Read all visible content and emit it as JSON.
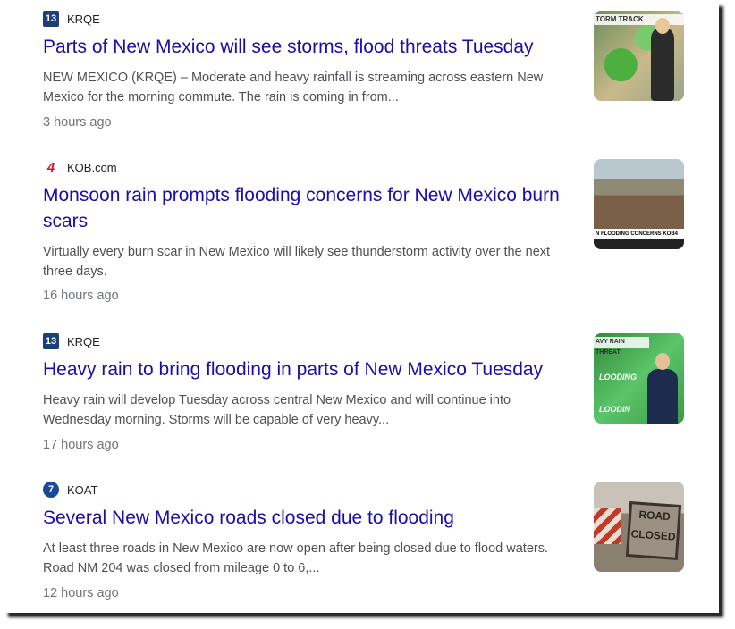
{
  "articles": [
    {
      "source": "KRQE",
      "logo": "13",
      "title": "Parts of New Mexico will see storms, flood threats Tuesday",
      "snippet": "NEW MEXICO (KRQE) – Moderate and heavy rainfall is streaming across eastern New Mexico for the morning commute. The rain is coming in from...",
      "time": "3 hours ago",
      "thumb_caption": "TORM TRACK"
    },
    {
      "source": "KOB.com",
      "logo": "4",
      "title": "Monsoon rain prompts flooding concerns for New Mexico burn scars",
      "snippet": "Virtually every burn scar in New Mexico will likely see thunderstorm activity over the next three days.",
      "time": "16 hours ago",
      "thumb_caption": "N FLOODING CONCERNS  KOB4"
    },
    {
      "source": "KRQE",
      "logo": "13",
      "title": "Heavy rain to bring flooding in parts of New Mexico Tuesday",
      "snippet": "Heavy rain will develop Tuesday across central New Mexico and will continue into Wednesday morning. Storms will be capable of very heavy...",
      "time": "17 hours ago",
      "thumb_caption": "AVY RAIN THREAT",
      "thumb_labels": [
        "LOODING",
        "LOODIN"
      ]
    },
    {
      "source": "KOAT",
      "logo": "7",
      "title": "Several New Mexico roads closed due to flooding",
      "snippet": "At least three roads in New Mexico are now open after being closed due to flood waters. Road NM 204 was closed from mileage 0 to 6,...",
      "time": "12 hours ago",
      "thumb_caption": "ROAD CLOSED"
    }
  ]
}
